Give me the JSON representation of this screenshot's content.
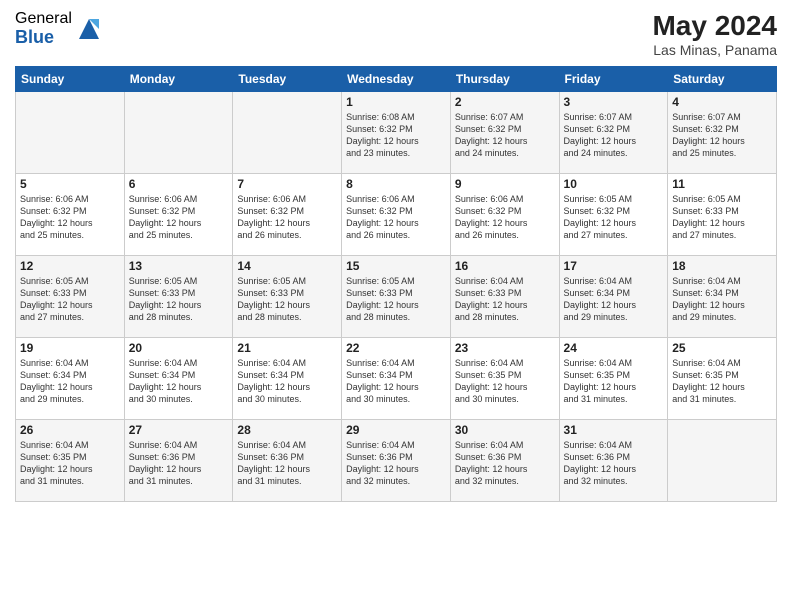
{
  "logo": {
    "general": "General",
    "blue": "Blue"
  },
  "title": "May 2024",
  "location": "Las Minas, Panama",
  "days_header": [
    "Sunday",
    "Monday",
    "Tuesday",
    "Wednesday",
    "Thursday",
    "Friday",
    "Saturday"
  ],
  "weeks": [
    [
      {
        "day": "",
        "text": ""
      },
      {
        "day": "",
        "text": ""
      },
      {
        "day": "",
        "text": ""
      },
      {
        "day": "1",
        "text": "Sunrise: 6:08 AM\nSunset: 6:32 PM\nDaylight: 12 hours\nand 23 minutes."
      },
      {
        "day": "2",
        "text": "Sunrise: 6:07 AM\nSunset: 6:32 PM\nDaylight: 12 hours\nand 24 minutes."
      },
      {
        "day": "3",
        "text": "Sunrise: 6:07 AM\nSunset: 6:32 PM\nDaylight: 12 hours\nand 24 minutes."
      },
      {
        "day": "4",
        "text": "Sunrise: 6:07 AM\nSunset: 6:32 PM\nDaylight: 12 hours\nand 25 minutes."
      }
    ],
    [
      {
        "day": "5",
        "text": "Sunrise: 6:06 AM\nSunset: 6:32 PM\nDaylight: 12 hours\nand 25 minutes."
      },
      {
        "day": "6",
        "text": "Sunrise: 6:06 AM\nSunset: 6:32 PM\nDaylight: 12 hours\nand 25 minutes."
      },
      {
        "day": "7",
        "text": "Sunrise: 6:06 AM\nSunset: 6:32 PM\nDaylight: 12 hours\nand 26 minutes."
      },
      {
        "day": "8",
        "text": "Sunrise: 6:06 AM\nSunset: 6:32 PM\nDaylight: 12 hours\nand 26 minutes."
      },
      {
        "day": "9",
        "text": "Sunrise: 6:06 AM\nSunset: 6:32 PM\nDaylight: 12 hours\nand 26 minutes."
      },
      {
        "day": "10",
        "text": "Sunrise: 6:05 AM\nSunset: 6:32 PM\nDaylight: 12 hours\nand 27 minutes."
      },
      {
        "day": "11",
        "text": "Sunrise: 6:05 AM\nSunset: 6:33 PM\nDaylight: 12 hours\nand 27 minutes."
      }
    ],
    [
      {
        "day": "12",
        "text": "Sunrise: 6:05 AM\nSunset: 6:33 PM\nDaylight: 12 hours\nand 27 minutes."
      },
      {
        "day": "13",
        "text": "Sunrise: 6:05 AM\nSunset: 6:33 PM\nDaylight: 12 hours\nand 28 minutes."
      },
      {
        "day": "14",
        "text": "Sunrise: 6:05 AM\nSunset: 6:33 PM\nDaylight: 12 hours\nand 28 minutes."
      },
      {
        "day": "15",
        "text": "Sunrise: 6:05 AM\nSunset: 6:33 PM\nDaylight: 12 hours\nand 28 minutes."
      },
      {
        "day": "16",
        "text": "Sunrise: 6:04 AM\nSunset: 6:33 PM\nDaylight: 12 hours\nand 28 minutes."
      },
      {
        "day": "17",
        "text": "Sunrise: 6:04 AM\nSunset: 6:34 PM\nDaylight: 12 hours\nand 29 minutes."
      },
      {
        "day": "18",
        "text": "Sunrise: 6:04 AM\nSunset: 6:34 PM\nDaylight: 12 hours\nand 29 minutes."
      }
    ],
    [
      {
        "day": "19",
        "text": "Sunrise: 6:04 AM\nSunset: 6:34 PM\nDaylight: 12 hours\nand 29 minutes."
      },
      {
        "day": "20",
        "text": "Sunrise: 6:04 AM\nSunset: 6:34 PM\nDaylight: 12 hours\nand 30 minutes."
      },
      {
        "day": "21",
        "text": "Sunrise: 6:04 AM\nSunset: 6:34 PM\nDaylight: 12 hours\nand 30 minutes."
      },
      {
        "day": "22",
        "text": "Sunrise: 6:04 AM\nSunset: 6:34 PM\nDaylight: 12 hours\nand 30 minutes."
      },
      {
        "day": "23",
        "text": "Sunrise: 6:04 AM\nSunset: 6:35 PM\nDaylight: 12 hours\nand 30 minutes."
      },
      {
        "day": "24",
        "text": "Sunrise: 6:04 AM\nSunset: 6:35 PM\nDaylight: 12 hours\nand 31 minutes."
      },
      {
        "day": "25",
        "text": "Sunrise: 6:04 AM\nSunset: 6:35 PM\nDaylight: 12 hours\nand 31 minutes."
      }
    ],
    [
      {
        "day": "26",
        "text": "Sunrise: 6:04 AM\nSunset: 6:35 PM\nDaylight: 12 hours\nand 31 minutes."
      },
      {
        "day": "27",
        "text": "Sunrise: 6:04 AM\nSunset: 6:36 PM\nDaylight: 12 hours\nand 31 minutes."
      },
      {
        "day": "28",
        "text": "Sunrise: 6:04 AM\nSunset: 6:36 PM\nDaylight: 12 hours\nand 31 minutes."
      },
      {
        "day": "29",
        "text": "Sunrise: 6:04 AM\nSunset: 6:36 PM\nDaylight: 12 hours\nand 32 minutes."
      },
      {
        "day": "30",
        "text": "Sunrise: 6:04 AM\nSunset: 6:36 PM\nDaylight: 12 hours\nand 32 minutes."
      },
      {
        "day": "31",
        "text": "Sunrise: 6:04 AM\nSunset: 6:36 PM\nDaylight: 12 hours\nand 32 minutes."
      },
      {
        "day": "",
        "text": ""
      }
    ]
  ]
}
